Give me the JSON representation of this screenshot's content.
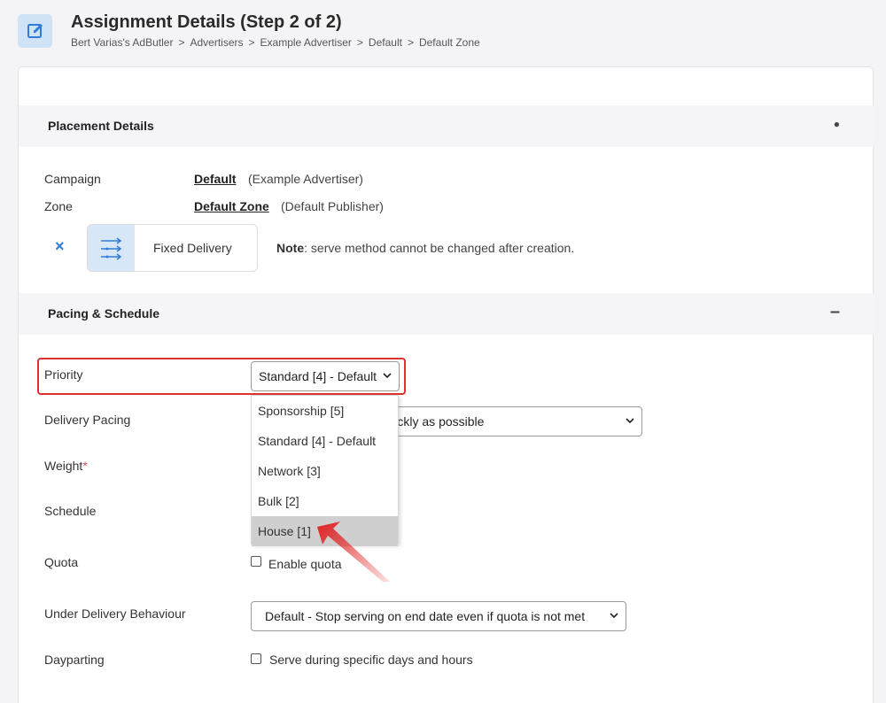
{
  "header": {
    "title": "Assignment Details (Step 2 of 2)",
    "breadcrumb": [
      "Bert Varias's AdButler",
      "Advertisers",
      "Example Advertiser",
      "Default",
      "Default Zone"
    ],
    "separator": ">"
  },
  "placement": {
    "title": "Placement Details",
    "toggle": "●",
    "campaign_label": "Campaign",
    "campaign_value": "Default",
    "campaign_owner": "(Example Advertiser)",
    "zone_label": "Zone",
    "zone_value": "Default Zone",
    "zone_owner": "(Default Publisher)",
    "remove_icon": "×",
    "delivery_method": "Fixed Delivery",
    "note_bold": "Note",
    "note_text": ": serve method cannot be changed after creation."
  },
  "pacing": {
    "title": "Pacing & Schedule",
    "toggle": "–",
    "priority_label": "Priority",
    "priority_value": "Standard [4] - Default",
    "priority_options": [
      "Sponsorship [5]",
      "Standard [4] - Default",
      "Network [3]",
      "Bulk [2]",
      "House [1]"
    ],
    "priority_highlighted": "House [1]",
    "delivery_pacing_label": "Delivery Pacing",
    "delivery_pacing_value": "Serve impressions as quickly as possible",
    "weight_label": "Weight",
    "weight_required": "*",
    "schedule_label": "Schedule",
    "quota_label": "Quota",
    "quota_checkbox": "Enable quota",
    "under_delivery_label": "Under Delivery Behaviour",
    "under_delivery_value": "Default - Stop serving on end date even if quota is not met",
    "dayparting_label": "Dayparting",
    "dayparting_checkbox": "Serve during specific days and hours"
  },
  "colors": {
    "accent": "#2f7bd6",
    "highlight": "#e03131",
    "icon_bg": "#cfe2f6"
  }
}
